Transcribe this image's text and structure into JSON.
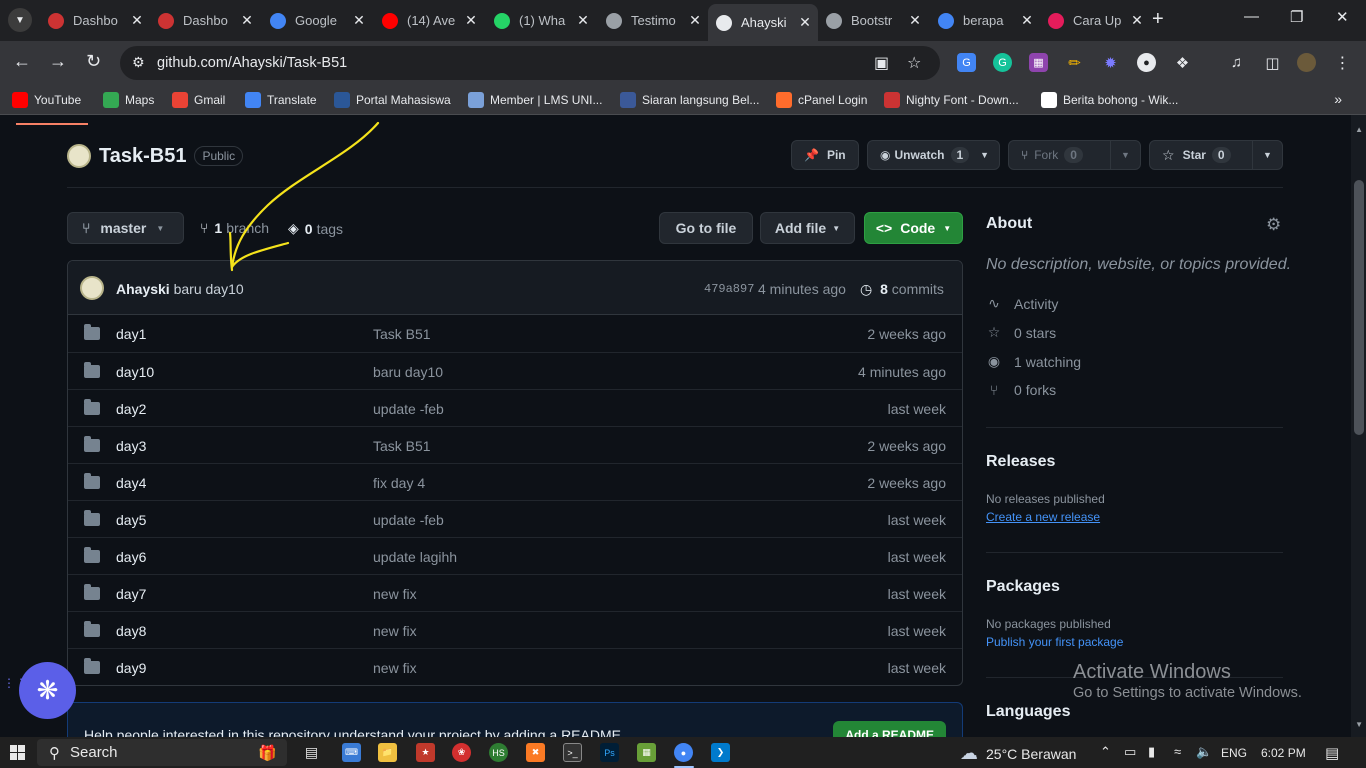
{
  "tabs": [
    {
      "label": "Dashbo",
      "color": "#c33"
    },
    {
      "label": "Dashbo",
      "color": "#c33"
    },
    {
      "label": "Google",
      "color": "#4285f4"
    },
    {
      "label": "(14) Ave",
      "color": "#f00"
    },
    {
      "label": "(1) Wha",
      "color": "#25d366"
    },
    {
      "label": "Testimo",
      "color": "#9aa0a6"
    },
    {
      "label": "Ahayski",
      "color": "#e8eaed",
      "active": true
    },
    {
      "label": "Bootstr",
      "color": "#9aa0a6"
    },
    {
      "label": "berapa",
      "color": "#4285f4"
    },
    {
      "label": "Cara Up",
      "color": "#e41c5b"
    }
  ],
  "toolbar": {
    "url": "github.com/Ahayski/Task-B51"
  },
  "bookmarks": [
    {
      "label": "YouTube",
      "color": "#f00"
    },
    {
      "label": "Maps",
      "color": "#34a853"
    },
    {
      "label": "Gmail",
      "color": "#ea4335"
    },
    {
      "label": "Translate",
      "color": "#4285f4"
    },
    {
      "label": "Portal Mahasiswa",
      "color": "#2b5797"
    },
    {
      "label": "Member | LMS UNI...",
      "color": "#7aa0d8"
    },
    {
      "label": "Siaran langsung Bel...",
      "color": "#3b5998"
    },
    {
      "label": "cPanel Login",
      "color": "#ff6c2c"
    },
    {
      "label": "Nighty Font - Down...",
      "color": "#c33"
    },
    {
      "label": "Berita bohong - Wik...",
      "color": "#ffffff"
    }
  ],
  "repo": {
    "name": "Task-B51",
    "visibility": "Public",
    "pin": "Pin",
    "unwatch": "Unwatch",
    "watch_count": "1",
    "fork": "Fork",
    "fork_count": "0",
    "star": "Star",
    "star_count": "0"
  },
  "controls": {
    "branch": "master",
    "branches_count": "1",
    "branches_label": "branch",
    "tags_count": "0",
    "tags_label": "tags",
    "go_to_file": "Go to file",
    "add_file": "Add file",
    "code": "Code"
  },
  "commit": {
    "user": "Ahayski",
    "message": "baru day10",
    "sha": "479a897",
    "time": "4 minutes ago",
    "count": "8",
    "count_label": "commits"
  },
  "files": [
    {
      "name": "day1",
      "message": "Task B51",
      "time": "2 weeks ago"
    },
    {
      "name": "day10",
      "message": "baru day10",
      "time": "4 minutes ago"
    },
    {
      "name": "day2",
      "message": "update -feb",
      "time": "last week"
    },
    {
      "name": "day3",
      "message": "Task B51",
      "time": "2 weeks ago"
    },
    {
      "name": "day4",
      "message": "fix day 4",
      "time": "2 weeks ago"
    },
    {
      "name": "day5",
      "message": "update -feb",
      "time": "last week"
    },
    {
      "name": "day6",
      "message": "update lagihh",
      "time": "last week"
    },
    {
      "name": "day7",
      "message": "new fix",
      "time": "last week"
    },
    {
      "name": "day8",
      "message": "new fix",
      "time": "last week"
    },
    {
      "name": "day9",
      "message": "new fix",
      "time": "last week"
    }
  ],
  "readme": {
    "text": "Help people interested in this repository understand your project by adding a README.",
    "button": "Add a README"
  },
  "sidebar": {
    "about_title": "About",
    "about_desc": "No description, website, or topics provided.",
    "activity": "Activity",
    "stars_count": "0",
    "stars_label": "stars",
    "watching_count": "1",
    "watching_label": "watching",
    "forks_count": "0",
    "forks_label": "forks",
    "releases_title": "Releases",
    "releases_none": "No releases published",
    "releases_link": "Create a new release",
    "packages_title": "Packages",
    "packages_none": "No packages published",
    "packages_link": "Publish your first package",
    "languages_title": "Languages"
  },
  "watermark": {
    "line1": "Activate Windows",
    "line2": "Go to Settings to activate Windows."
  },
  "taskbar": {
    "search": "Search",
    "weather": "25°C  Berawan",
    "lang": "ENG",
    "time": "6:02 PM"
  }
}
